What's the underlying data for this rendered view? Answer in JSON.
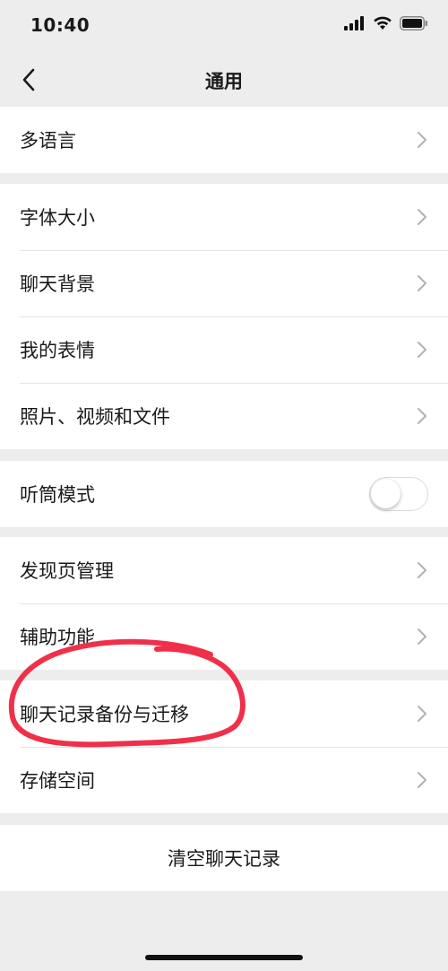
{
  "status_bar": {
    "time": "10:40"
  },
  "nav": {
    "title": "通用"
  },
  "groups": [
    {
      "items": [
        {
          "label": "多语言"
        }
      ]
    },
    {
      "items": [
        {
          "label": "字体大小"
        },
        {
          "label": "聊天背景"
        },
        {
          "label": "我的表情"
        },
        {
          "label": "照片、视频和文件"
        }
      ]
    },
    {
      "items": [
        {
          "label": "听筒模式",
          "toggle": false
        }
      ]
    },
    {
      "items": [
        {
          "label": "发现页管理"
        },
        {
          "label": "辅助功能"
        }
      ]
    },
    {
      "items": [
        {
          "label": "聊天记录备份与迁移"
        },
        {
          "label": "存储空间"
        }
      ]
    }
  ],
  "clear_history": {
    "label": "清空聊天记录"
  },
  "colors": {
    "background": "#ededed",
    "card": "#ffffff",
    "text": "#1a1a1a",
    "chevron": "#b2b2b2",
    "annotation": "#f0304a"
  },
  "icons": {
    "back": "chevron-left-icon",
    "row_arrow": "chevron-right-icon",
    "signal": "signal-icon",
    "wifi": "wifi-icon",
    "battery": "battery-icon"
  }
}
